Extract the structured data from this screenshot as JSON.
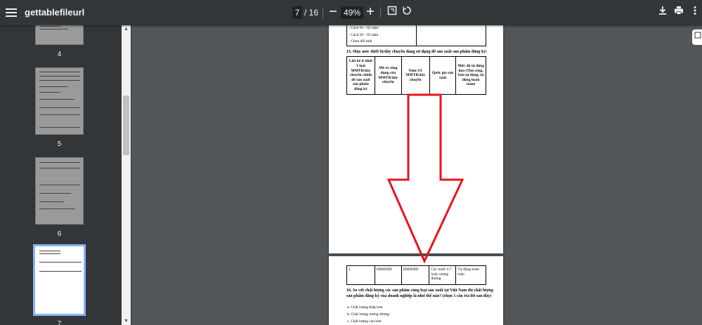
{
  "toolbar": {
    "title": "gettablefileurl",
    "current_page": "7",
    "total_pages": "/ 16",
    "zoom": "49%",
    "zoom_out_icon": "minus-icon",
    "zoom_in_icon": "plus-icon"
  },
  "sidebar": {
    "pages": [
      {
        "label": "4"
      },
      {
        "label": "5"
      },
      {
        "label": "6"
      },
      {
        "label": "7"
      }
    ]
  },
  "document": {
    "top_items": [
      "- Cách 01 - 02 năm",
      "- Cách 03 - 05 năm",
      "- Chưa đổi mới"
    ],
    "q15_title": "15. Máy móc thiết bị/dây chuyền đang sử dụng để sản xuất sản phẩm đăng ký:",
    "q15_headers": [
      "Liệt kê ít nhất 1 loại MMTB/dây chuyền chính để sản xuất sản phẩm đăng ký",
      "Mô tả công dụng của MMTB/dây chuyền",
      "Năm SX MMTB/dây chuyền",
      "Quốc gia sản xuất",
      "Mức độ tự động hóa (Thủ công, bán tự động, tự động hoàn toàn)"
    ],
    "q15_row": [
      "1",
      "IIIIIIIIIIII",
      "IIIIIIIIIIII",
      "Các nước G7 hoặc tương đương",
      "Tự động hoàn toàn"
    ],
    "q16_title": "16. So với chất lượng các sản phẩm cùng loại sản xuất tại Việt Nam thì chất lượng sản phẩm đăng ký của doanh nghiệp là như thế nào? (chọn 1 câu trả lời sau đây)",
    "q16_options": [
      "a. Chất lượng thấp hơn",
      "b. Chất lượng tương đương",
      "c. Chất lượng cao hơn"
    ]
  },
  "annotation": {
    "arrow_color": "#e8141c"
  }
}
